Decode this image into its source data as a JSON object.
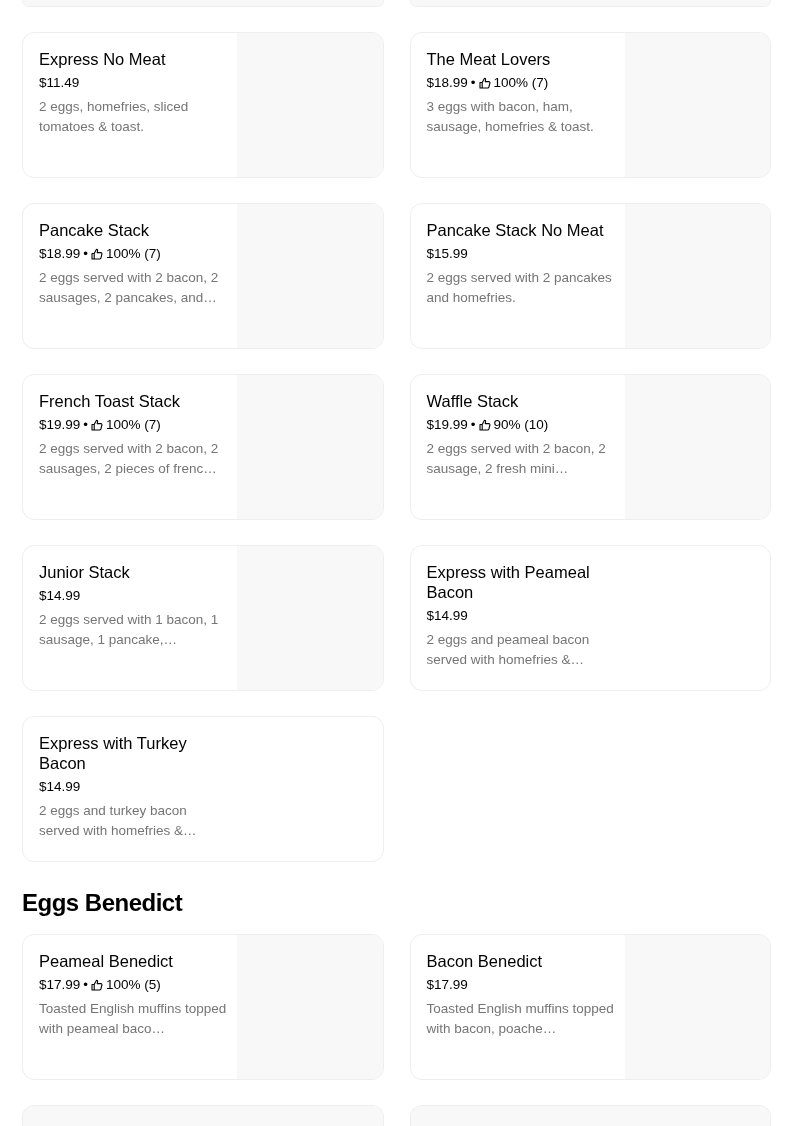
{
  "sections": [
    {
      "items": [
        {
          "name": "Express No Meat",
          "price": "$11.49",
          "description": "2 eggs, homefries, sliced tomatoes & toast.",
          "has_photo": true
        },
        {
          "name": "The Meat Lovers",
          "price": "$18.99",
          "separator": "•",
          "rating": "100% (7)",
          "description": "3 eggs with bacon, ham, sausage, homefries & toast.",
          "has_photo": true
        },
        {
          "name": "Pancake Stack",
          "price": "$18.99",
          "separator": "•",
          "rating": "100% (7)",
          "description": "2 eggs served with 2 bacon, 2 sausages, 2 pancakes, and…",
          "has_photo": true
        },
        {
          "name": "Pancake Stack No Meat",
          "price": "$15.99",
          "description": "2 eggs served with 2 pancakes and homefries.",
          "has_photo": true
        },
        {
          "name": "French Toast Stack",
          "price": "$19.99",
          "separator": "•",
          "rating": "100% (7)",
          "description": "2 eggs served with 2 bacon, 2 sausages, 2 pieces of frenc…",
          "has_photo": true
        },
        {
          "name": "Waffle Stack",
          "price": "$19.99",
          "separator": "•",
          "rating": "90% (10)",
          "description": "2 eggs served with 2 bacon, 2 sausage, 2 fresh mini…",
          "has_photo": true
        },
        {
          "name": "Junior Stack",
          "price": "$14.99",
          "description": "2 eggs served with 1 bacon, 1 sausage, 1 pancake,…",
          "has_photo": true
        },
        {
          "name": "Express with Peameal Bacon",
          "price": "$14.99",
          "description": "2 eggs and peameal bacon served with homefries &…",
          "has_photo": false
        },
        {
          "name": "Express with Turkey Bacon",
          "price": "$14.99",
          "description": "2 eggs and turkey bacon served with homefries &…",
          "has_photo": false
        }
      ]
    },
    {
      "heading": "Eggs Benedict",
      "items": [
        {
          "name": "Peameal Benedict",
          "price": "$17.99",
          "separator": "•",
          "rating": "100% (5)",
          "description": "Toasted English muffins topped with peameal baco…",
          "has_photo": true
        },
        {
          "name": "Bacon Benedict",
          "price": "$17.99",
          "description": "Toasted English muffins topped with bacon, poache…",
          "has_photo": true
        }
      ]
    }
  ]
}
